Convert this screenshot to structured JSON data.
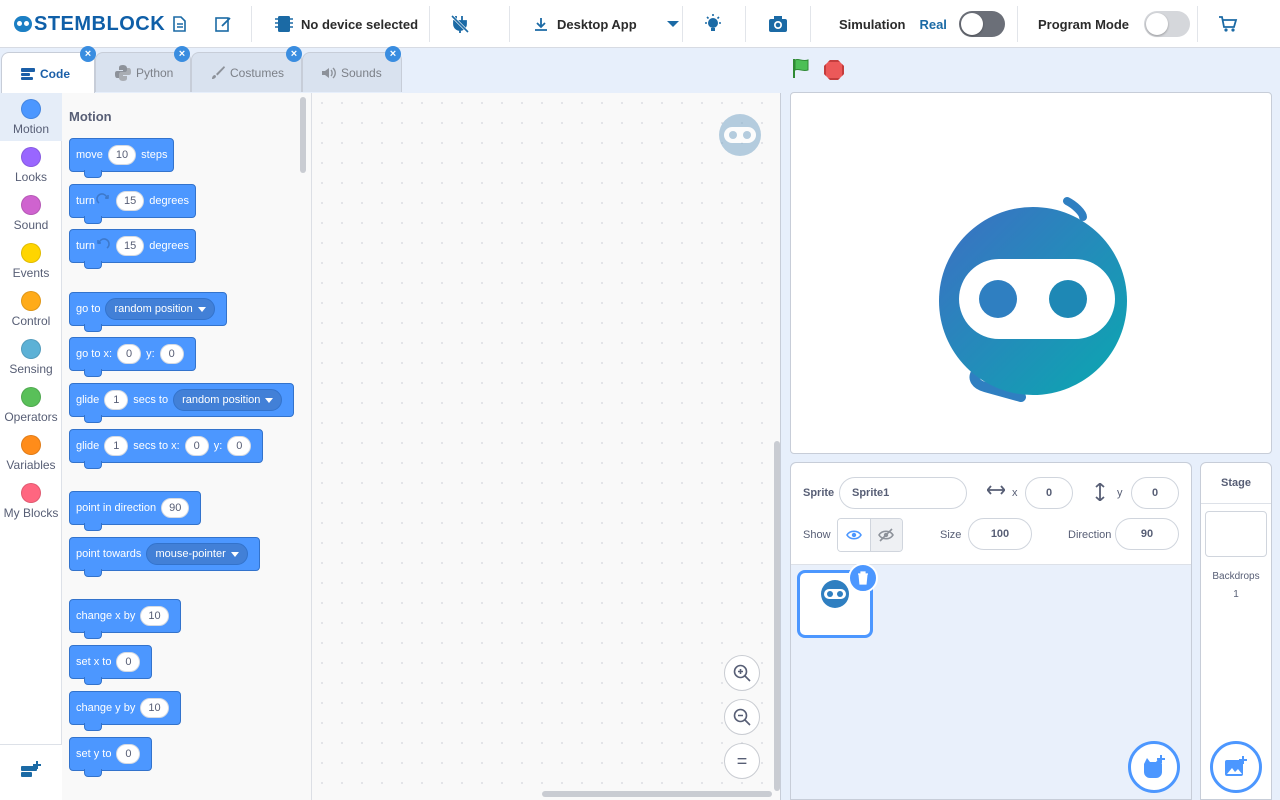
{
  "header": {
    "logo": "STEMBLOCK",
    "device": "No device selected",
    "app_mode": "Desktop App",
    "simulation_label": "Simulation",
    "real_label": "Real",
    "program_mode_label": "Program Mode",
    "icons": [
      "file-icon",
      "edit-icon",
      "board-icon",
      "plug-icon",
      "download-icon",
      "dropdown-icon",
      "bulb-icon",
      "camera-icon",
      "cart-icon"
    ],
    "simulation_toggle": "on",
    "program_mode_toggle": "off"
  },
  "tabs": [
    {
      "label": "Code",
      "active": true
    },
    {
      "label": "Python",
      "active": false
    },
    {
      "label": "Costumes",
      "active": false
    },
    {
      "label": "Sounds",
      "active": false
    }
  ],
  "categories": [
    {
      "label": "Motion",
      "color": "#4c97ff"
    },
    {
      "label": "Looks",
      "color": "#9966ff"
    },
    {
      "label": "Sound",
      "color": "#cf63cf"
    },
    {
      "label": "Events",
      "color": "#ffd500"
    },
    {
      "label": "Control",
      "color": "#ffab19"
    },
    {
      "label": "Sensing",
      "color": "#5cb1d6"
    },
    {
      "label": "Operators",
      "color": "#59c059"
    },
    {
      "label": "Variables",
      "color": "#ff8c1a"
    },
    {
      "label": "My Blocks",
      "color": "#ff6680"
    }
  ],
  "palette": {
    "title": "Motion",
    "blocks": {
      "move": {
        "a": "move",
        "v": "10",
        "b": "steps"
      },
      "turn_r": {
        "a": "turn",
        "v": "15",
        "b": "degrees"
      },
      "turn_l": {
        "a": "turn",
        "v": "15",
        "b": "degrees"
      },
      "goto": {
        "a": "go to",
        "opt": "random position"
      },
      "goto_xy": {
        "a": "go to x:",
        "x": "0",
        "y_lbl": "y:",
        "y": "0"
      },
      "glide": {
        "a": "glide",
        "v": "1",
        "b": "secs to",
        "opt": "random position"
      },
      "glide_xy": {
        "a": "glide",
        "v": "1",
        "b": "secs to x:",
        "x": "0",
        "y_lbl": "y:",
        "y": "0"
      },
      "point_dir": {
        "a": "point in direction",
        "v": "90"
      },
      "point_towards": {
        "a": "point towards",
        "opt": "mouse-pointer"
      },
      "change_x": {
        "a": "change x by",
        "v": "10"
      },
      "set_x": {
        "a": "set x to",
        "v": "0"
      },
      "change_y": {
        "a": "change y by",
        "v": "10"
      },
      "set_y": {
        "a": "set y to",
        "v": "0"
      }
    }
  },
  "workspace": {
    "zoom_in": "+",
    "zoom_out": "−",
    "reset": "="
  },
  "sprite_panel": {
    "sprite_label": "Sprite",
    "sprite_name": "Sprite1",
    "x_label": "x",
    "x": "0",
    "y_label": "y",
    "y": "0",
    "show_label": "Show",
    "size_label": "Size",
    "size": "100",
    "direction_label": "Direction",
    "direction": "90"
  },
  "stage_panel": {
    "title": "Stage",
    "backdrops_label": "Backdrops",
    "backdrops_count": "1"
  },
  "colors": {
    "accent": "#4c97ff",
    "brand": "#0f5fa8",
    "robot_blue": "#2f7fc1",
    "robot_teal": "#0aa0b5"
  }
}
